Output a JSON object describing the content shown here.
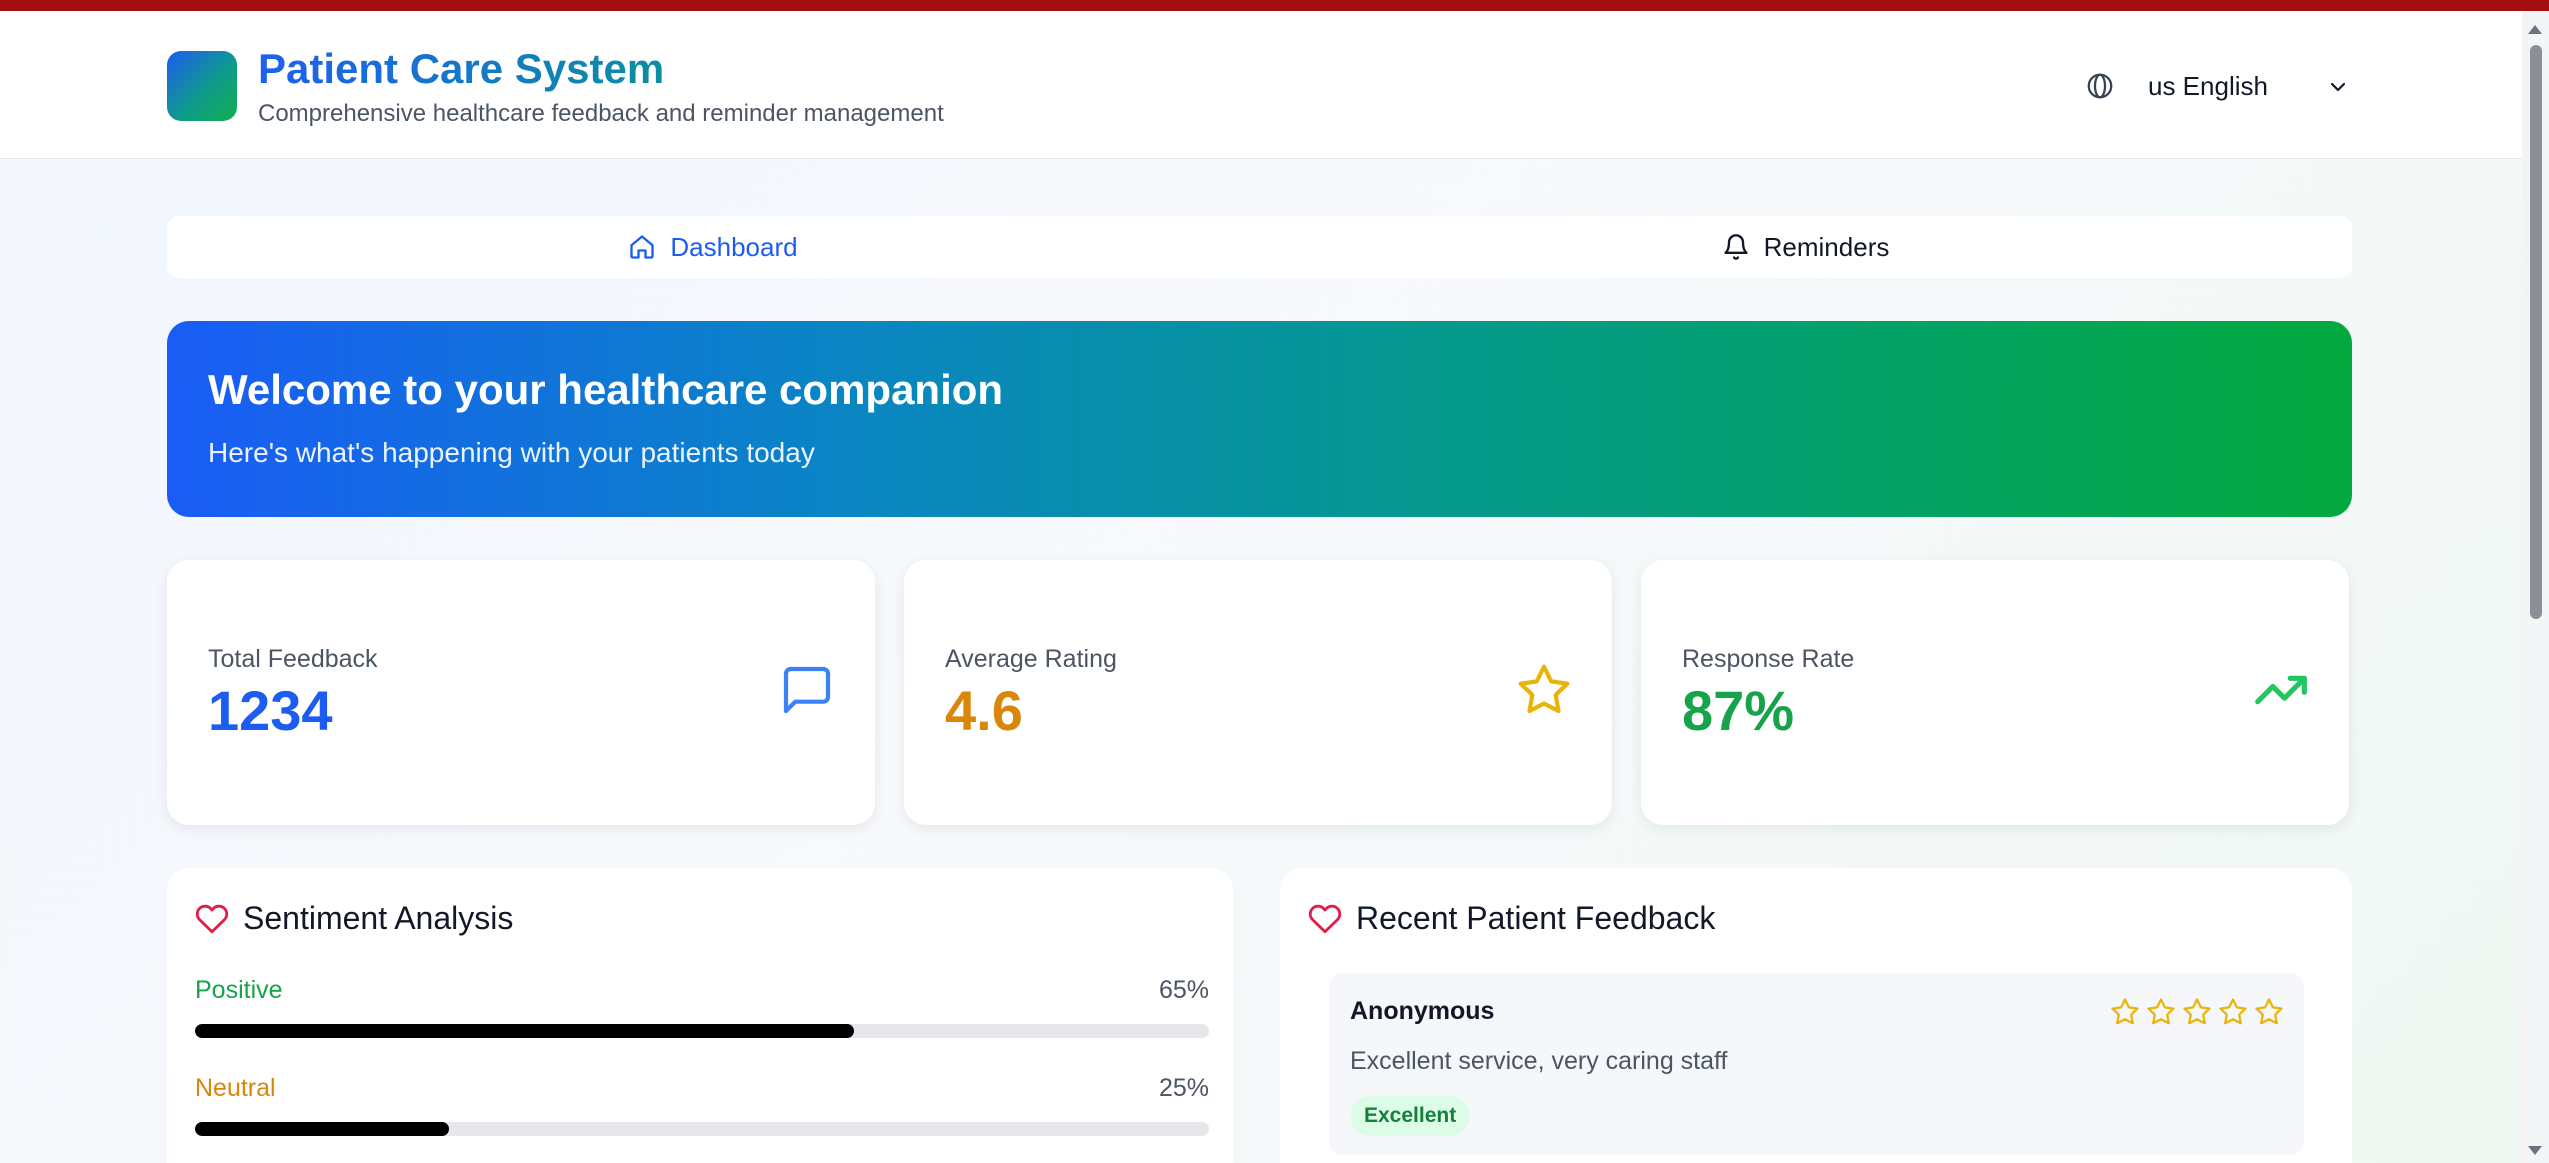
{
  "header": {
    "title": "Patient Care System",
    "subtitle": "Comprehensive healthcare feedback and reminder management",
    "language": {
      "icon": "globe-icon",
      "selected": "us English"
    }
  },
  "tabs": [
    {
      "label": "Dashboard",
      "icon": "home-icon",
      "active": true
    },
    {
      "label": "Reminders",
      "icon": "bell-icon",
      "active": false
    }
  ],
  "banner": {
    "title": "Welcome to your healthcare companion",
    "subtitle": "Here's what's happening with your patients today"
  },
  "stats": [
    {
      "label": "Total Feedback",
      "value": "1234",
      "icon": "message-square-icon",
      "color": "#1d5cf0"
    },
    {
      "label": "Average Rating",
      "value": "4.6",
      "icon": "star-icon",
      "color": "#d9870a"
    },
    {
      "label": "Response Rate",
      "value": "87%",
      "icon": "trending-up-icon",
      "color": "#16a34a"
    }
  ],
  "sentiment": {
    "title": "Sentiment Analysis",
    "icon": "heart-icon",
    "items": [
      {
        "label": "Positive",
        "percent": "65%",
        "fraction": 0.65,
        "color": "#16a34a"
      },
      {
        "label": "Neutral",
        "percent": "25%",
        "fraction": 0.25,
        "color": "#d9870a"
      }
    ]
  },
  "recent_feedback": {
    "title": "Recent Patient Feedback",
    "icon": "heart-icon",
    "items": [
      {
        "author": "Anonymous",
        "rating_stars": 5,
        "text": "Excellent service, very caring staff",
        "badge": "Excellent"
      }
    ]
  },
  "colors": {
    "brand_blue": "#1d5cf0",
    "brand_green": "#03a93e",
    "heart": "#e11d48",
    "star": "#eab308"
  }
}
